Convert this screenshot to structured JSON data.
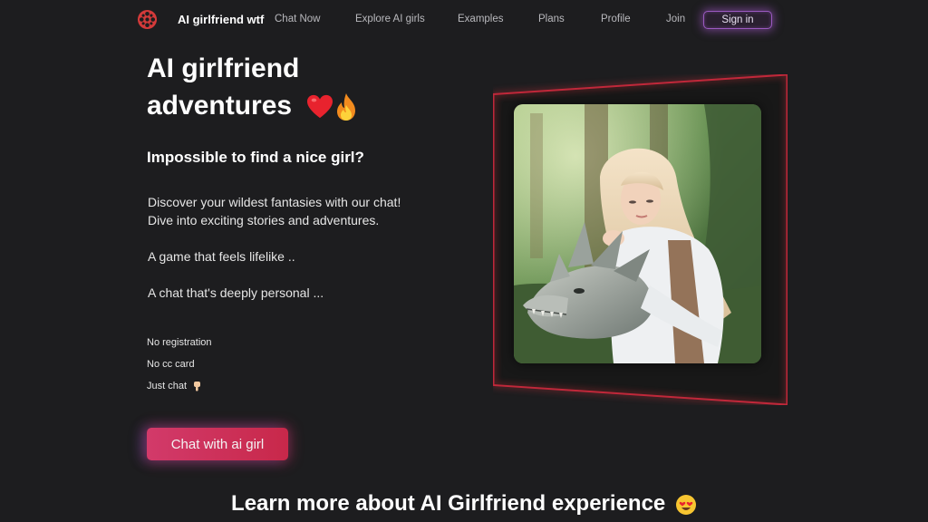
{
  "nav": {
    "brand": "AI girlfriend wtf",
    "links": [
      {
        "label": "Chat Now"
      },
      {
        "label": "Explore AI girls"
      },
      {
        "label": "Examples"
      },
      {
        "label": "Plans"
      },
      {
        "label": "Profile"
      },
      {
        "label": "Join"
      }
    ],
    "signin_label": "Sign in"
  },
  "hero": {
    "title_line1": "AI girlfriend",
    "title_line2": "adventures",
    "title_emojis": [
      "red-heart",
      "fire"
    ],
    "subtitle": "Impossible to find a nice girl?",
    "paragraphs": [
      "Discover your wildest fantasies with our chat!",
      "Dive into exciting stories and adventures.",
      "A game that feels lifelike ..",
      "A chat that's deeply personal ..."
    ],
    "features": [
      "No registration",
      "No cc card",
      "Just chat"
    ],
    "features_trailing_icon": "pointing-down-hand",
    "cta_label": "Chat with ai girl"
  },
  "image": {
    "subject": "fantasy-woman-with-dragon-illustration"
  },
  "learn_more": {
    "heading": "Learn more about AI Girlfriend experience",
    "emoji": "heart-eyes-face"
  },
  "colors": {
    "background": "#1d1d1f",
    "accent_pink": "#d23a6a",
    "signin_glow": "#9a5ac0",
    "frame_glow": "#c0283a"
  }
}
